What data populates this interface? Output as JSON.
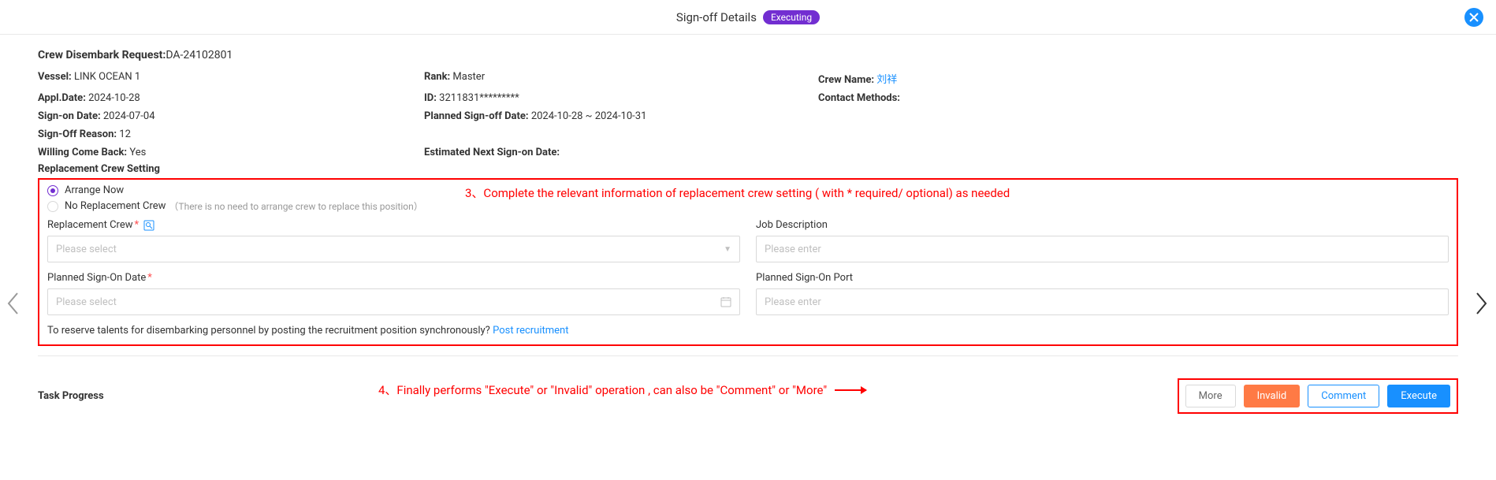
{
  "header": {
    "title": "Sign-off Details",
    "badge": "Executing"
  },
  "request": {
    "label": "Crew Disembark Request:",
    "number": "DA-24102801"
  },
  "info": {
    "vessel_label": "Vessel:",
    "vessel_value": "LINK OCEAN 1",
    "rank_label": "Rank:",
    "rank_value": "Master",
    "crew_name_label": "Crew Name:",
    "crew_name_value": "刘祥",
    "appl_date_label": "Appl.Date:",
    "appl_date_value": "2024-10-28",
    "id_label": "ID:",
    "id_value": "3211831*********",
    "contact_label": "Contact Methods:",
    "contact_value": "",
    "signon_date_label": "Sign-on Date:",
    "signon_date_value": "2024-07-04",
    "planned_signoff_label": "Planned Sign-off Date:",
    "planned_signoff_value": "2024-10-28 ~ 2024-10-31",
    "signoff_reason_label": "Sign-Off Reason:",
    "signoff_reason_value": "12",
    "willing_back_label": "Willing Come Back:",
    "willing_back_value": "Yes",
    "est_next_label": "Estimated Next Sign-on Date:",
    "est_next_value": ""
  },
  "replacement": {
    "section_label": "Replacement Crew Setting",
    "radio_arrange": "Arrange Now",
    "radio_none": "No Replacement Crew",
    "radio_none_hint": "（There is no need to arrange crew to replace this position）",
    "crew_label": "Replacement Crew",
    "crew_placeholder": "Please select",
    "job_label": "Job Description",
    "job_placeholder": "Please enter",
    "date_label": "Planned Sign-On Date",
    "date_placeholder": "Please select",
    "port_label": "Planned Sign-On Port",
    "port_placeholder": "Please enter",
    "helper_text": "To reserve talents for disembarking personnel by posting the recruitment position synchronously?",
    "helper_link": "Post recruitment"
  },
  "annotations": {
    "step3": "3、Complete the relevant information of replacement crew setting ( with * required/ optional) as needed",
    "step4": "4、Finally performs \"Execute\" or \"Invalid\" operation , can also be \"Comment\" or \"More\""
  },
  "footer": {
    "task_progress": "Task Progress",
    "btn_more": "More",
    "btn_invalid": "Invalid",
    "btn_comment": "Comment",
    "btn_execute": "Execute"
  }
}
